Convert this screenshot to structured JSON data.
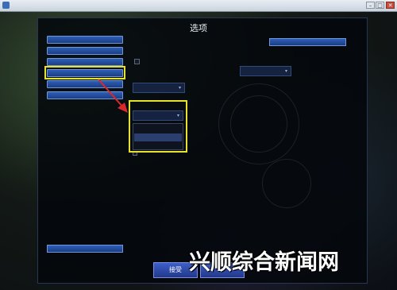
{
  "window": {
    "title": "",
    "minimize": "–",
    "maximize": "□",
    "close": "✕"
  },
  "dialog": {
    "title": "选项"
  },
  "nav": {
    "items": [
      {
        "label": ""
      },
      {
        "label": ""
      },
      {
        "label": ""
      },
      {
        "label": ""
      },
      {
        "label": ""
      },
      {
        "label": ""
      }
    ],
    "close_button": ""
  },
  "settings": {
    "section_title": "",
    "checkbox_label": "",
    "dropdown1_label": "",
    "dropdown1_value": "",
    "dropdown2_label": "",
    "dropdown2_value": "",
    "dropdown3_label": "",
    "dropdown3_value": "",
    "options": [
      "",
      "",
      ""
    ],
    "selected_option_index": 1,
    "hidden_checkbox_label": "",
    "reset_button": ""
  },
  "footer": {
    "accept_label": "接受",
    "cancel_label": ""
  },
  "watermark": {
    "text": "兴顺综合新闻网"
  },
  "colors": {
    "highlight": "#e6e32a",
    "arrow": "#d8282c",
    "button": "#2d5fb8"
  }
}
